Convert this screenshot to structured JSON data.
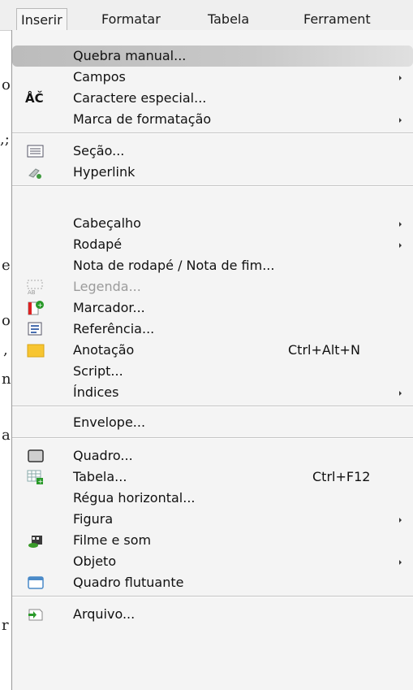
{
  "menubar": {
    "items": [
      "Inserir",
      "Formatar",
      "Tabela",
      "Ferrament"
    ]
  },
  "doc_fragments": [
    "o",
    ",;",
    "e",
    "o",
    ",",
    "n",
    "a",
    "r"
  ],
  "menu": {
    "items": [
      {
        "label": "Quebra manual...",
        "shortcut": "",
        "submenu": false,
        "disabled": false,
        "icon": ""
      },
      {
        "label": "Campos",
        "shortcut": "",
        "submenu": true,
        "disabled": false,
        "icon": ""
      },
      {
        "label": "Caractere especial...",
        "shortcut": "",
        "submenu": false,
        "disabled": false,
        "icon": "special-character-icon"
      },
      {
        "label": "Marca de formatação",
        "shortcut": "",
        "submenu": true,
        "disabled": false,
        "icon": ""
      },
      {
        "label": "Seção...",
        "shortcut": "",
        "submenu": false,
        "disabled": false,
        "icon": "section-icon"
      },
      {
        "label": "Hyperlink",
        "shortcut": "",
        "submenu": false,
        "disabled": false,
        "icon": "hyperlink-icon"
      },
      {
        "label": "Cabeçalho",
        "shortcut": "",
        "submenu": true,
        "disabled": false,
        "icon": ""
      },
      {
        "label": "Rodapé",
        "shortcut": "",
        "submenu": true,
        "disabled": false,
        "icon": ""
      },
      {
        "label": "Nota de rodapé / Nota de fim...",
        "shortcut": "",
        "submenu": false,
        "disabled": false,
        "icon": ""
      },
      {
        "label": "Legenda...",
        "shortcut": "",
        "submenu": false,
        "disabled": true,
        "icon": "caption-icon"
      },
      {
        "label": "Marcador...",
        "shortcut": "",
        "submenu": false,
        "disabled": false,
        "icon": "bookmark-icon"
      },
      {
        "label": "Referência...",
        "shortcut": "",
        "submenu": false,
        "disabled": false,
        "icon": "cross-reference-icon"
      },
      {
        "label": "Anotação",
        "shortcut": "Ctrl+Alt+N",
        "submenu": false,
        "disabled": false,
        "icon": "comment-icon"
      },
      {
        "label": "Script...",
        "shortcut": "",
        "submenu": false,
        "disabled": false,
        "icon": ""
      },
      {
        "label": "Índices",
        "shortcut": "",
        "submenu": true,
        "disabled": false,
        "icon": ""
      },
      {
        "label": "Envelope...",
        "shortcut": "",
        "submenu": false,
        "disabled": false,
        "icon": ""
      },
      {
        "label": "Quadro...",
        "shortcut": "",
        "submenu": false,
        "disabled": false,
        "icon": "frame-icon"
      },
      {
        "label": "Tabela...",
        "shortcut": "Ctrl+F12",
        "submenu": false,
        "disabled": false,
        "icon": "table-icon"
      },
      {
        "label": "Régua horizontal...",
        "shortcut": "",
        "submenu": false,
        "disabled": false,
        "icon": ""
      },
      {
        "label": "Figura",
        "shortcut": "",
        "submenu": true,
        "disabled": false,
        "icon": ""
      },
      {
        "label": "Filme e som",
        "shortcut": "",
        "submenu": false,
        "disabled": false,
        "icon": "movie-sound-icon"
      },
      {
        "label": "Objeto",
        "shortcut": "",
        "submenu": true,
        "disabled": false,
        "icon": ""
      },
      {
        "label": "Quadro flutuante",
        "shortcut": "",
        "submenu": false,
        "disabled": false,
        "icon": "floating-frame-icon"
      },
      {
        "label": "Arquivo...",
        "shortcut": "",
        "submenu": false,
        "disabled": false,
        "icon": "insert-file-icon"
      }
    ]
  },
  "colors": {
    "menu_bg": "#f4f4f4",
    "highlight": "#c4c4c4",
    "disabled_text": "#9b9b9b",
    "comment_icon": "#f7c531"
  }
}
